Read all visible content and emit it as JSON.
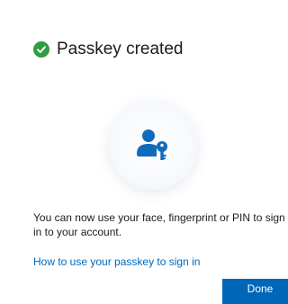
{
  "dialog": {
    "title": "Passkey created",
    "message_line1": "You can now use your face, fingerprint or PIN to sign",
    "message_line2": "in to your account.",
    "help_link": "How to use your passkey to sign in",
    "done_label": "Done"
  },
  "icons": {
    "status": "check-circle-icon",
    "illustration": "passkey-user-key-icon"
  },
  "colors": {
    "success": "#2e9e3e",
    "accent": "#0067b8",
    "text": "#1b1b1b"
  }
}
